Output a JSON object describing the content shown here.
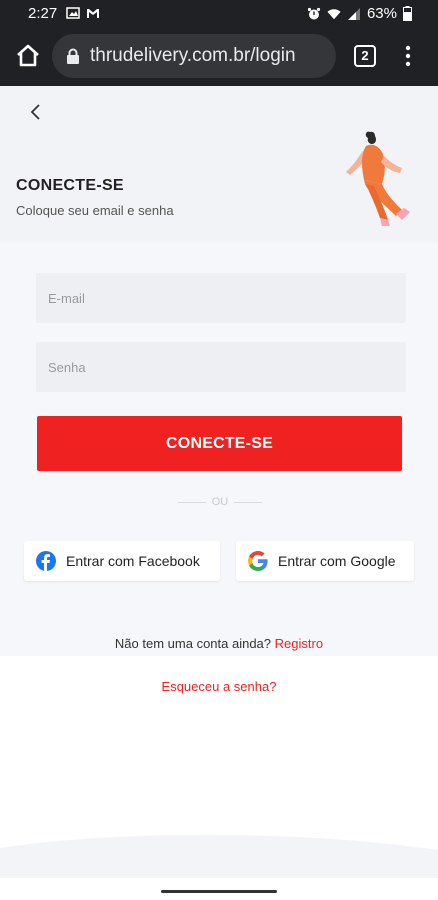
{
  "status_bar": {
    "time": "2:27",
    "battery": "63%"
  },
  "browser": {
    "url": "thrudelivery.com.br/login",
    "tab_count": "2"
  },
  "page": {
    "title": "CONECTE-SE",
    "subtitle": "Coloque seu email e senha",
    "email_placeholder": "E-mail",
    "password_placeholder": "Senha",
    "login_button": "CONECTE-SE",
    "divider_text": "OU",
    "facebook_button": "Entrar com Facebook",
    "google_button": "Entrar com Google",
    "no_account_text": "Não tem uma conta ainda?",
    "register_link": "Registro",
    "forgot_password_link": "Esqueceu a senha?"
  },
  "colors": {
    "accent": "#ef2121",
    "facebook": "#1877f2",
    "browser_chrome": "#202124"
  },
  "icons": {
    "back": "chevron-left-icon",
    "home": "home-icon",
    "lock": "lock-icon",
    "menu": "more-vert-icon",
    "facebook": "facebook-icon",
    "google": "google-icon"
  }
}
